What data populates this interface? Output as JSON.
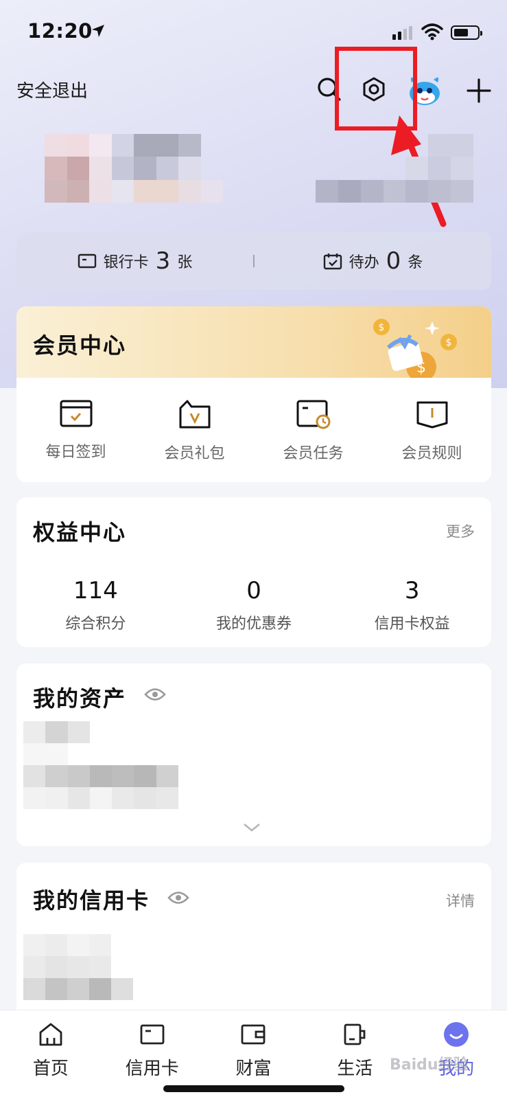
{
  "status_bar": {
    "time": "12:20"
  },
  "header": {
    "logout_label": "安全退出"
  },
  "icons": {
    "search": "search-icon",
    "settings": "settings-icon",
    "avatar": "mascot-avatar-icon",
    "add": "plus-icon"
  },
  "stats": {
    "bank_card_label": "银行卡",
    "bank_card_count": "3",
    "bank_card_unit": "张",
    "todo_label": "待办",
    "todo_count": "0",
    "todo_unit": "条"
  },
  "member": {
    "title": "会员中心",
    "items": [
      {
        "label": "每日签到",
        "icon": "checkin-icon"
      },
      {
        "label": "会员礼包",
        "icon": "gift-pack-icon"
      },
      {
        "label": "会员任务",
        "icon": "task-icon"
      },
      {
        "label": "会员规则",
        "icon": "rules-icon"
      }
    ]
  },
  "rights": {
    "title": "权益中心",
    "more_label": "更多",
    "items": [
      {
        "value": "114",
        "label": "综合积分"
      },
      {
        "value": "0",
        "label": "我的优惠券"
      },
      {
        "value": "3",
        "label": "信用卡权益"
      }
    ]
  },
  "assets": {
    "title": "我的资产"
  },
  "credit": {
    "title": "我的信用卡",
    "detail_label": "详情"
  },
  "tabbar": {
    "items": [
      {
        "label": "首页",
        "icon": "home-icon"
      },
      {
        "label": "信用卡",
        "icon": "credit-card-icon"
      },
      {
        "label": "财富",
        "icon": "wallet-icon"
      },
      {
        "label": "生活",
        "icon": "cup-icon"
      },
      {
        "label": "我的",
        "icon": "profile-icon"
      }
    ]
  },
  "watermark": "Baidu经验",
  "colors": {
    "accent": "#5a60e0",
    "highlight": "#ec1c24",
    "gold": "#c58a2a"
  }
}
